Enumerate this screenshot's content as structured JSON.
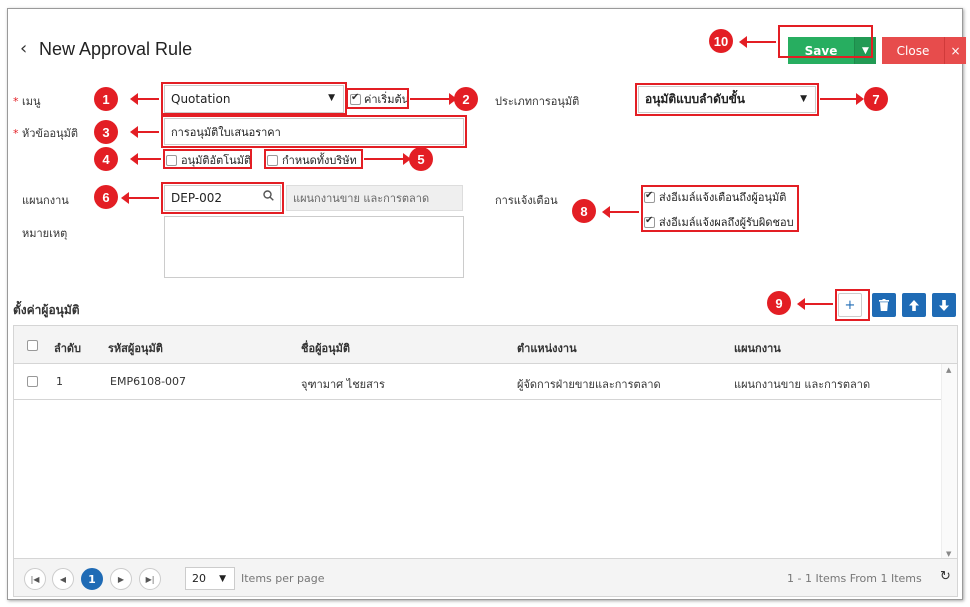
{
  "header": {
    "back_icon": "‹",
    "title": "New Approval Rule",
    "save_label": "Save",
    "close_label": "Close",
    "close_x": "×"
  },
  "form": {
    "menu_label": "เมนู",
    "menu_value": "Quotation",
    "default_label": "ค่าเริ่มต้น",
    "topic_label": "หัวข้ออนุมัติ",
    "topic_value": "การอนุมัติใบเสนอราคา",
    "auto_approve_label": "อนุมัติอัตโนมัติ",
    "all_company_label": "กำหนดทั้งบริษัท",
    "department_label": "แผนกงาน",
    "department_code": "DEP-002",
    "department_name": "แผนกงานขาย และการตลาด",
    "remark_label": "หมายเหตุ",
    "approval_type_label": "ประเภทการอนุมัติ",
    "approval_type_value": "อนุมัติแบบลำดับขั้น",
    "notify_label": "การแจ้งเตือน",
    "notify_option_1": "ส่งอีเมล์แจ้งเตือนถึงผู้อนุมัติ",
    "notify_option_2": "ส่งอีเมล์แจ้งผลถึงผู้รับผิดชอบ"
  },
  "approvers": {
    "section_title": "ตั้งค่าผู้อนุมัติ",
    "columns": [
      "ลำดับ",
      "รหัสผู้อนุมัติ",
      "ชื่อผู้อนุมัติ",
      "ตำแหน่งงาน",
      "แผนกงาน"
    ],
    "rows": [
      [
        "1",
        "EMP6108-007",
        "จุฑามาศ ไชยสาร",
        "ผู้จัดการฝ่ายขายและการตลาด",
        "แผนกงานขาย และการตลาด"
      ]
    ],
    "add_glyph": "+"
  },
  "pager": {
    "current_page": "1",
    "page_size": "20",
    "items_per_page": "Items per page",
    "summary": "1 - 1 Items From 1 Items"
  },
  "callouts": [
    "1",
    "2",
    "3",
    "4",
    "5",
    "6",
    "7",
    "8",
    "9",
    "10"
  ],
  "colors": {
    "save": "#27ae60",
    "close": "#e74c4c",
    "callout": "#e31e24",
    "add": "#ffffff",
    "delete": "#1f6bb5",
    "pager_active": "#1f6bb5"
  },
  "icons": [
    "back-icon",
    "caret-down-icon",
    "search-icon",
    "plus-icon",
    "trash-icon",
    "arrow-up-icon",
    "arrow-down-icon",
    "refresh-icon"
  ]
}
